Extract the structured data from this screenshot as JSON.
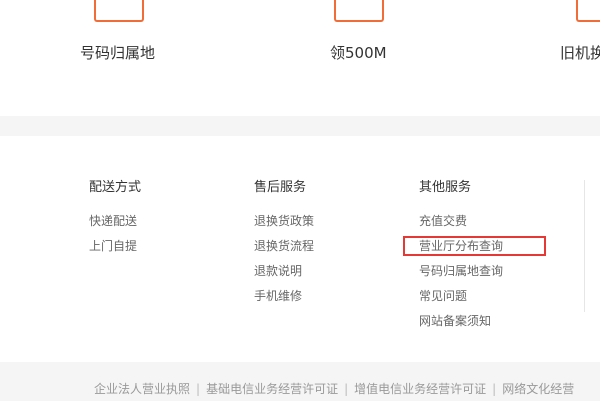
{
  "quick_links": [
    {
      "label": "号码归属地"
    },
    {
      "label": "领500M"
    },
    {
      "label": "旧机换"
    }
  ],
  "footer": {
    "columns": [
      {
        "title": "配送方式",
        "links": [
          "快递配送",
          "上门自提"
        ]
      },
      {
        "title": "售后服务",
        "links": [
          "退换货政策",
          "退换货流程",
          "退款说明",
          "手机维修"
        ]
      },
      {
        "title": "其他服务",
        "links": [
          "充值交费",
          "营业厅分布查询",
          "号码归属地查询",
          "常见问题",
          "网站备案须知"
        ]
      }
    ]
  },
  "licenses": [
    "企业法人营业执照",
    "基础电信业务经营许可证",
    "增值电信业务经营许可证",
    "网络文化经营"
  ],
  "colors": {
    "accent": "#f06d3a",
    "highlight": "#e53935"
  }
}
